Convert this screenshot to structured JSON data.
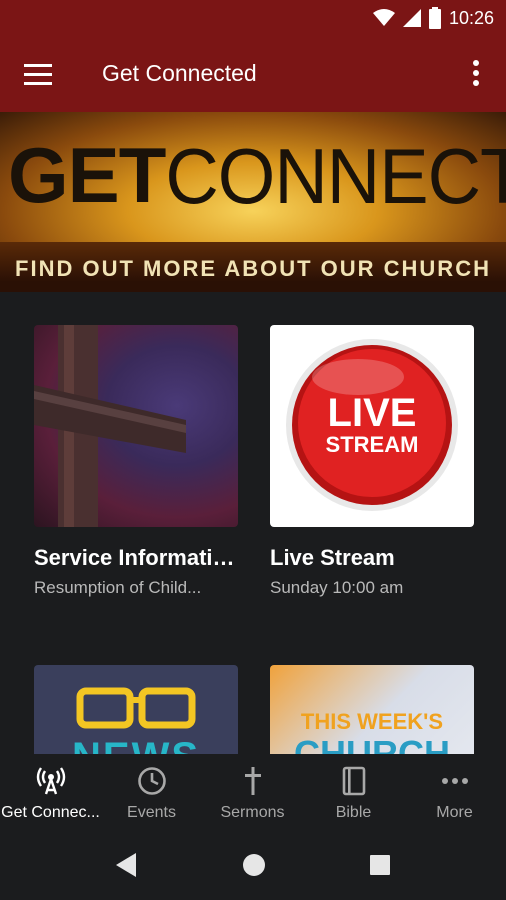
{
  "status": {
    "time": "10:26"
  },
  "app_bar": {
    "title": "Get Connected"
  },
  "banner": {
    "word_bold": "GET",
    "word_light": "CONNECTED",
    "subtitle": "FIND OUT MORE ABOUT OUR CHURCH"
  },
  "cards": [
    {
      "title": "Service Information Up...",
      "subtitle": "Resumption of Child..."
    },
    {
      "title": "Live Stream",
      "subtitle": "Sunday 10:00 am",
      "image_text_top": "LIVE",
      "image_text_bottom": "STREAM"
    },
    {
      "title": "",
      "subtitle": "",
      "image_text": "NEWS"
    },
    {
      "title": "",
      "subtitle": "",
      "image_text_top": "THIS WEEK'S",
      "image_text_bottom": "CHURCH"
    }
  ],
  "bottom_nav": [
    {
      "label": "Get Connec...",
      "icon": "broadcast-icon",
      "active": true
    },
    {
      "label": "Events",
      "icon": "clock-icon"
    },
    {
      "label": "Sermons",
      "icon": "cross-icon"
    },
    {
      "label": "Bible",
      "icon": "book-icon"
    },
    {
      "label": "More",
      "icon": "more-horizontal-icon"
    }
  ],
  "colors": {
    "primary": "#7b1515",
    "background": "#1b1c1e",
    "text_secondary": "#b9b9b9",
    "live_red": "#d81e1e"
  }
}
